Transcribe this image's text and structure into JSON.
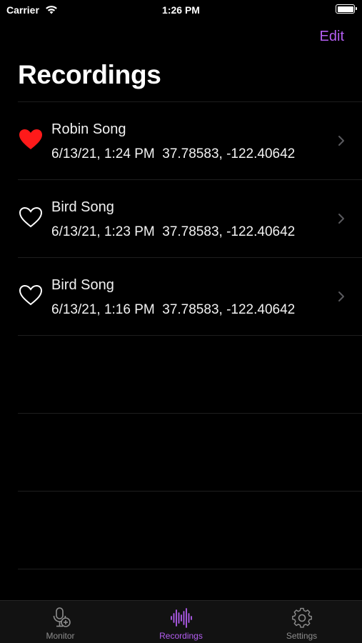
{
  "status_bar": {
    "carrier": "Carrier",
    "time": "1:26 PM"
  },
  "nav": {
    "edit_label": "Edit",
    "title": "Recordings"
  },
  "recordings": [
    {
      "title": "Robin Song",
      "detail": "6/13/21, 1:24 PM  37.78583, -122.40642",
      "favorite": true
    },
    {
      "title": "Bird Song",
      "detail": "6/13/21, 1:23 PM  37.78583, -122.40642",
      "favorite": false
    },
    {
      "title": "Bird Song",
      "detail": "6/13/21, 1:16 PM  37.78583, -122.40642",
      "favorite": false
    }
  ],
  "tabs": [
    {
      "label": "Monitor",
      "icon": "microphone-plus-icon",
      "active": false
    },
    {
      "label": "Recordings",
      "icon": "waveform-icon",
      "active": true
    },
    {
      "label": "Settings",
      "icon": "gear-icon",
      "active": false
    }
  ],
  "colors": {
    "accent": "#b45ef2",
    "favorite": "#ff1a1a",
    "background": "#000000",
    "tab_inactive": "#8e8e8e"
  }
}
